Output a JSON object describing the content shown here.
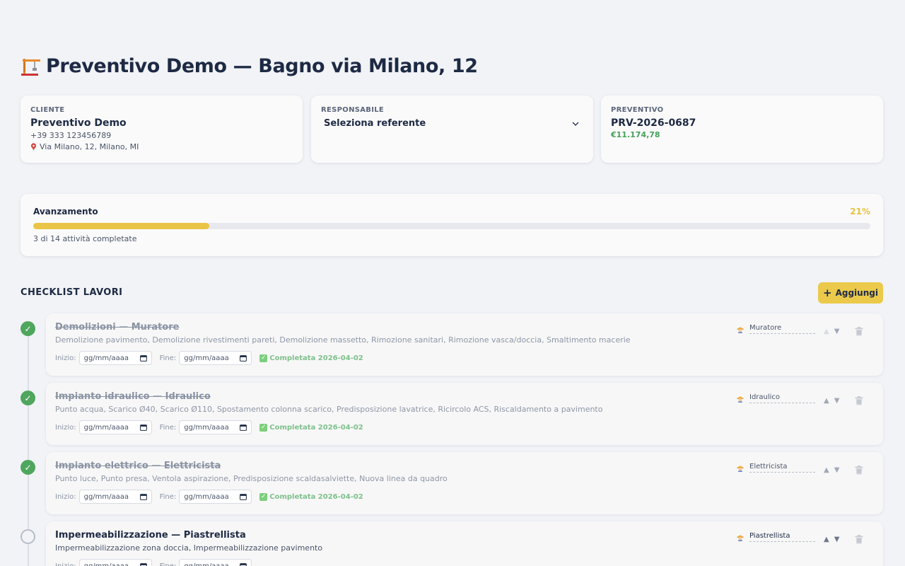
{
  "header": {
    "title": "Preventivo Demo — Bagno via Milano, 12",
    "icon": "crane-icon"
  },
  "client": {
    "label": "CLIENTE",
    "name": "Preventivo Demo",
    "phone": "+39 333 123456789",
    "address": "Via Milano, 12, Milano, MI"
  },
  "responsible": {
    "label": "RESPONSABILE",
    "selected": "Seleziona referente"
  },
  "quote": {
    "label": "PREVENTIVO",
    "code": "PRV-2026-0687",
    "amount": "€11.174,78"
  },
  "progress": {
    "title": "Avanzamento",
    "percent_label": "21%",
    "percent": 21,
    "summary": "3 di 14 attività completate"
  },
  "checklist": {
    "title": "CHECKLIST LAVORI",
    "add_label": "Aggiungi",
    "start_label": "Inizio:",
    "end_label": "Fine:",
    "date_placeholder": "gg/mm/aaaa",
    "tasks": [
      {
        "name": "Demolizioni — Muratore",
        "desc": "Demolizione pavimento, Demolizione rivestimenti pareti, Demolizione massetto, Rimozione sanitari, Rimozione vasca/doccia, Smaltimento macerie",
        "worker": "Muratore",
        "completed": "Completata 2026-04-02",
        "done": true
      },
      {
        "name": "Impianto idraulico — Idraulico",
        "desc": "Punto acqua, Scarico Ø40, Scarico Ø110, Spostamento colonna scarico, Predisposizione lavatrice, Ricircolo ACS, Riscaldamento a pavimento",
        "worker": "Idraulico",
        "completed": "Completata 2026-04-02",
        "done": true
      },
      {
        "name": "Impianto elettrico — Elettricista",
        "desc": "Punto luce, Punto presa, Ventola aspirazione, Predisposizione scaldasalviette, Nuova linea da quadro",
        "worker": "Elettricista",
        "completed": "Completata 2026-04-02",
        "done": true
      },
      {
        "name": "Impermeabilizzazione — Piastrellista",
        "desc": "Impermeabilizzazione zona doccia, Impermeabilizzazione pavimento",
        "worker": "Piastrellista",
        "completed": "",
        "done": false
      }
    ]
  },
  "colors": {
    "accent": "#ebc94b",
    "done": "#4fa65d",
    "price": "#46a05b",
    "text": "#1e2a44"
  }
}
